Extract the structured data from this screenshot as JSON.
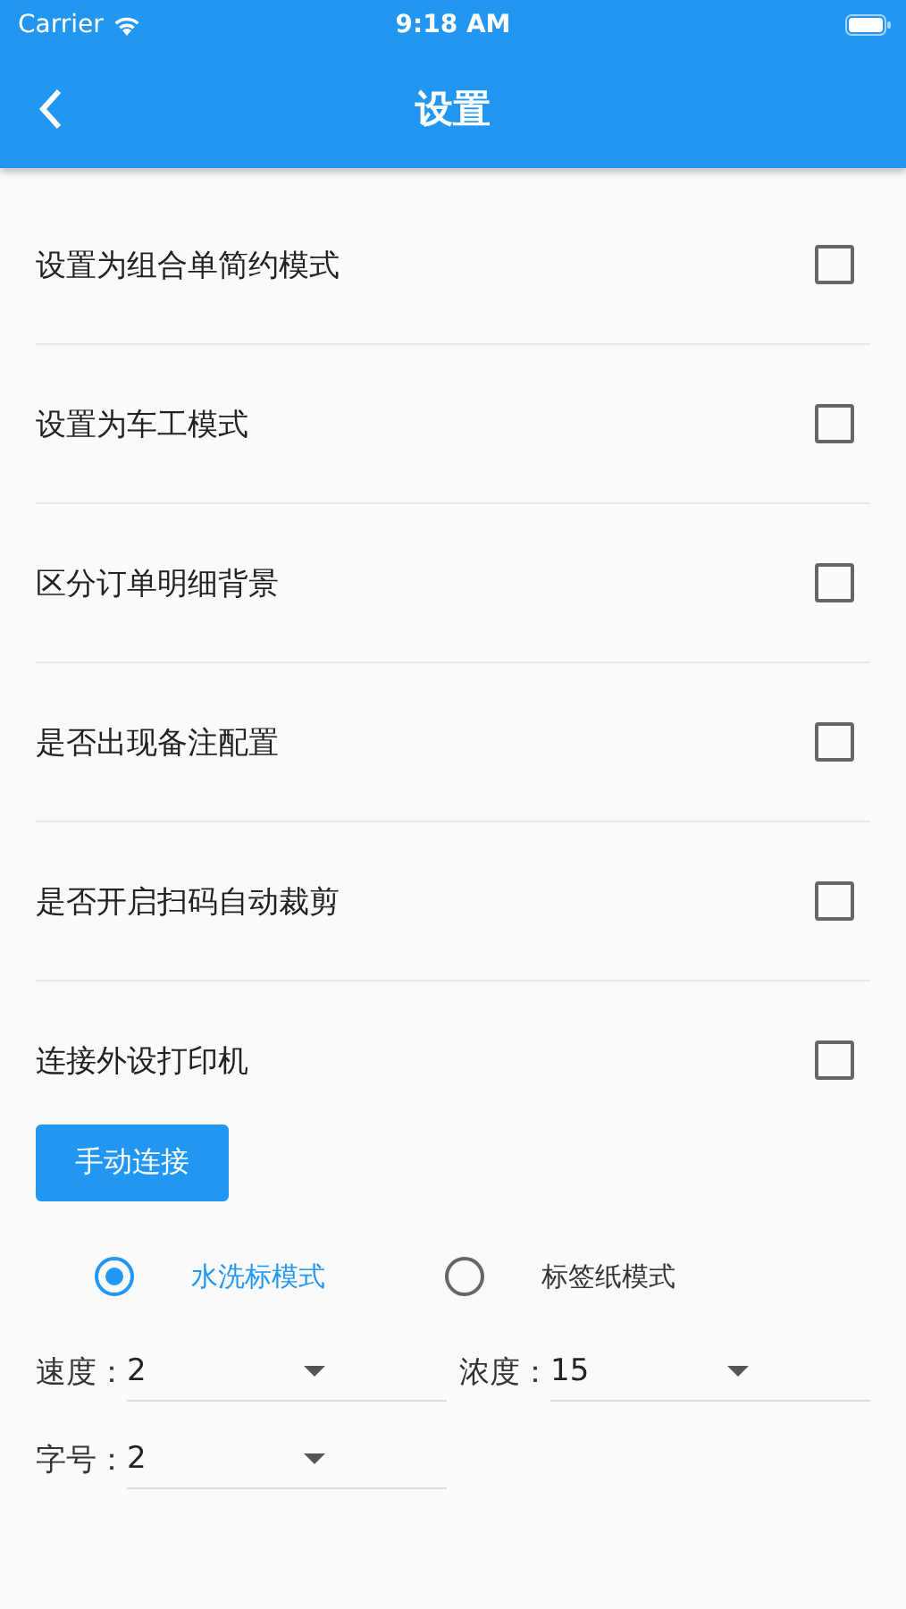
{
  "status_bar": {
    "carrier": "Carrier",
    "time": "9:18 AM"
  },
  "app_bar": {
    "title": "设置"
  },
  "settings": [
    {
      "label": "设置为组合单简约模式",
      "checked": false
    },
    {
      "label": "设置为车工模式",
      "checked": false
    },
    {
      "label": "区分订单明细背景",
      "checked": false
    },
    {
      "label": "是否出现备注配置",
      "checked": false
    },
    {
      "label": "是否开启扫码自动裁剪",
      "checked": false
    },
    {
      "label": "连接外设打印机",
      "checked": false
    }
  ],
  "connect_button": "手动连接",
  "modes": [
    {
      "label": "水洗标模式",
      "selected": true
    },
    {
      "label": "标签纸模式",
      "selected": false
    }
  ],
  "dropdowns": [
    {
      "label": "速度：",
      "value": "2"
    },
    {
      "label": "浓度：",
      "value": "15"
    },
    {
      "label": "字号：",
      "value": "2"
    }
  ]
}
